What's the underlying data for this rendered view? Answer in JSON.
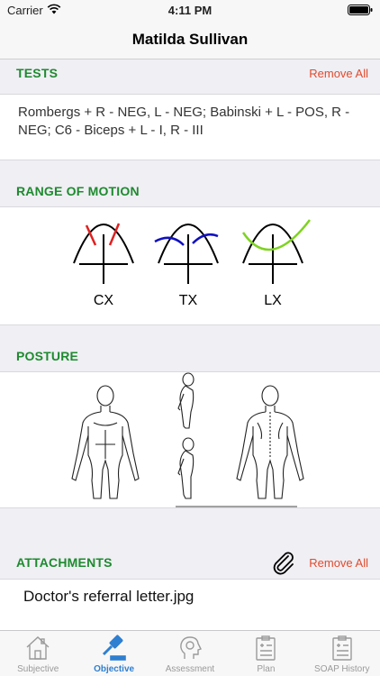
{
  "status_bar": {
    "carrier": "Carrier",
    "time": "4:11 PM"
  },
  "nav": {
    "title": "Matilda Sullivan"
  },
  "tests": {
    "title": "TESTS",
    "remove_all": "Remove All",
    "text": "Rombergs + R - NEG, L - NEG; Babinski + L - POS, R - NEG; C6 - Biceps + L - I, R - III"
  },
  "range_of_motion": {
    "title": "RANGE OF MOTION",
    "labels": [
      "CX",
      "TX",
      "LX"
    ],
    "colors": [
      "#e02020",
      "#1010c0",
      "#7ed321"
    ]
  },
  "posture": {
    "title": "POSTURE"
  },
  "attachments": {
    "title": "ATTACHMENTS",
    "remove_all": "Remove All",
    "file_name": "Doctor's referral letter.jpg"
  },
  "tabs": [
    {
      "label": "Subjective",
      "icon": "house-icon",
      "active": false
    },
    {
      "label": "Objective",
      "icon": "gavel-icon",
      "active": true
    },
    {
      "label": "Assessment",
      "icon": "assessment-icon",
      "active": false
    },
    {
      "label": "Plan",
      "icon": "clipboard-icon",
      "active": false
    },
    {
      "label": "SOAP History",
      "icon": "history-icon",
      "active": false
    }
  ]
}
